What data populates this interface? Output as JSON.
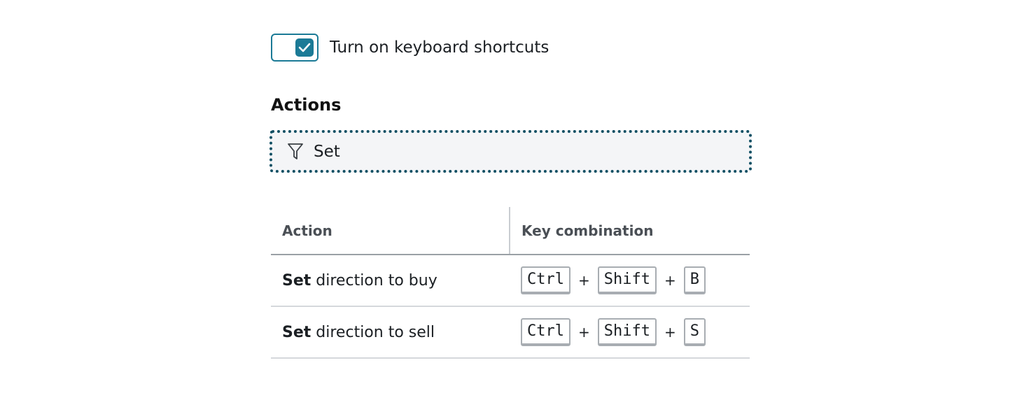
{
  "toggle": {
    "label": "Turn on keyboard shortcuts",
    "checked": true,
    "accent_color": "#1b7a96"
  },
  "actions": {
    "title": "Actions"
  },
  "filter": {
    "value": "Set",
    "icon": "filter-icon"
  },
  "table": {
    "columns": [
      "Action",
      "Key combination"
    ],
    "rows": [
      {
        "verb": "Set",
        "rest": "direction to buy",
        "keys": [
          "Ctrl",
          "Shift",
          "B"
        ]
      },
      {
        "verb": "Set",
        "rest": "direction to sell",
        "keys": [
          "Ctrl",
          "Shift",
          "S"
        ]
      }
    ],
    "separator": "+"
  }
}
